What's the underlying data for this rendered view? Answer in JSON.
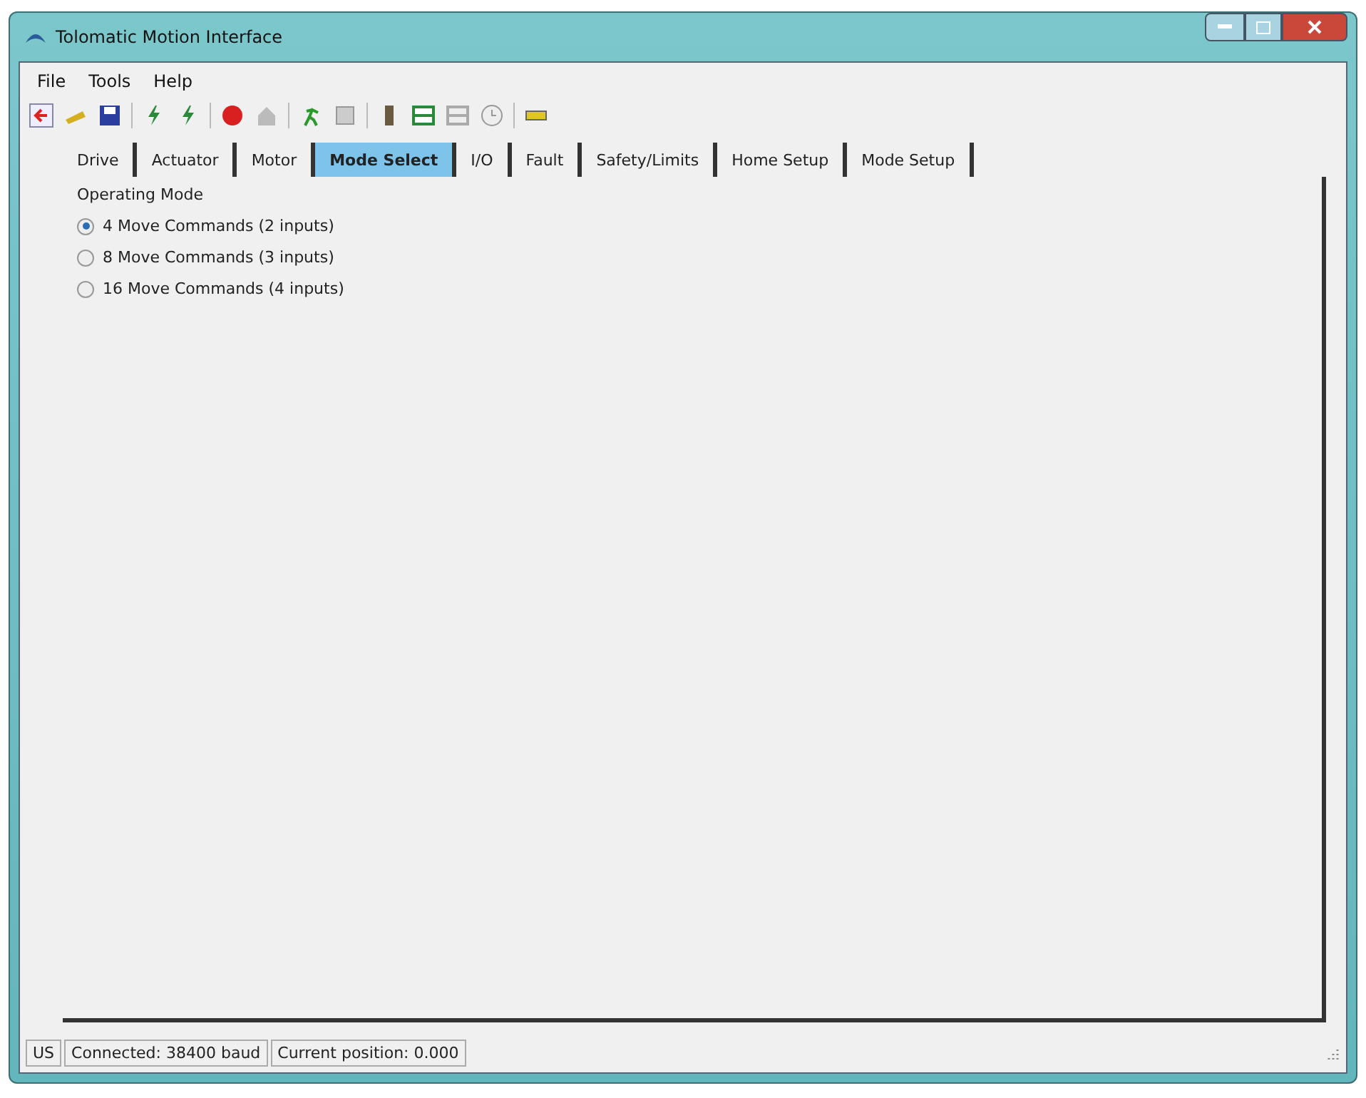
{
  "window": {
    "title": "Tolomatic Motion Interface"
  },
  "menu": [
    "File",
    "Tools",
    "Help"
  ],
  "tabs": [
    {
      "label": "Drive",
      "selected": false
    },
    {
      "label": "Actuator",
      "selected": false
    },
    {
      "label": "Motor",
      "selected": false
    },
    {
      "label": "Mode Select",
      "selected": true
    },
    {
      "label": "I/O",
      "selected": false
    },
    {
      "label": "Fault",
      "selected": false
    },
    {
      "label": "Safety/Limits",
      "selected": false
    },
    {
      "label": "Home Setup",
      "selected": false
    },
    {
      "label": "Mode Setup",
      "selected": false
    }
  ],
  "operating_mode": {
    "title": "Operating Mode",
    "options": [
      {
        "label": "4 Move Commands (2 inputs)",
        "selected": true
      },
      {
        "label": "8 Move Commands (3 inputs)",
        "selected": false
      },
      {
        "label": "16 Move Commands (4 inputs)",
        "selected": false
      }
    ]
  },
  "status_bar": [
    "US",
    "Connected: 38400 baud",
    "Current position: 0.000"
  ]
}
